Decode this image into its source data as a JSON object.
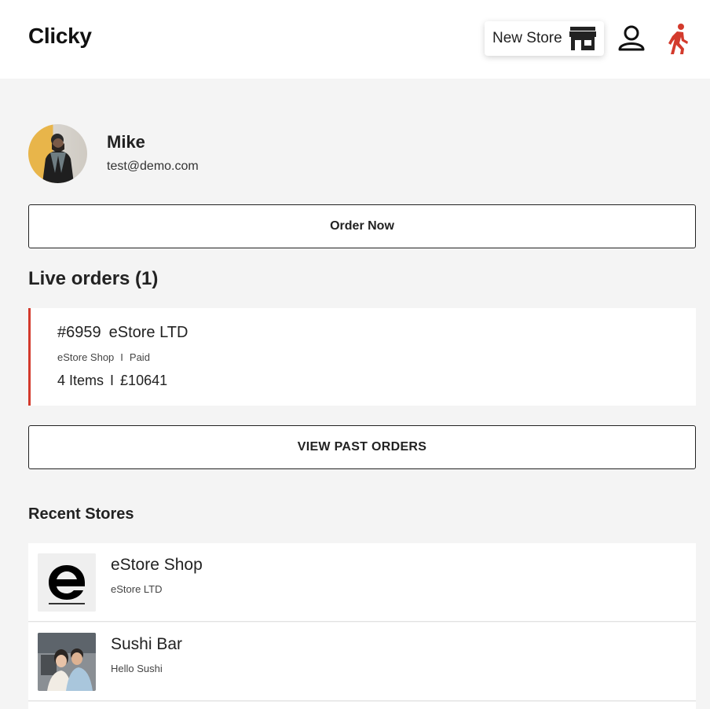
{
  "header": {
    "brand": "Clicky",
    "new_store_label": "New Store",
    "icons": [
      "store-icon",
      "user-icon",
      "walking-person-icon"
    ],
    "accent_color": "#d33a2c"
  },
  "profile": {
    "name": "Mike",
    "email": "test@demo.com"
  },
  "actions": {
    "order_now": "Order Now",
    "view_past_orders": "VIEW PAST ORDERS"
  },
  "live_orders": {
    "title": "Live orders (1)",
    "orders": [
      {
        "number": "#6959",
        "merchant": "eStore LTD",
        "store": "eStore Shop",
        "separator": "I",
        "status": "Paid",
        "items": "4 Items",
        "total": "£10641"
      }
    ]
  },
  "recent_stores": {
    "title": "Recent Stores",
    "stores": [
      {
        "name": "eStore Shop",
        "subtitle": "eStore LTD"
      },
      {
        "name": "Sushi Bar",
        "subtitle": "Hello Sushi"
      }
    ]
  }
}
